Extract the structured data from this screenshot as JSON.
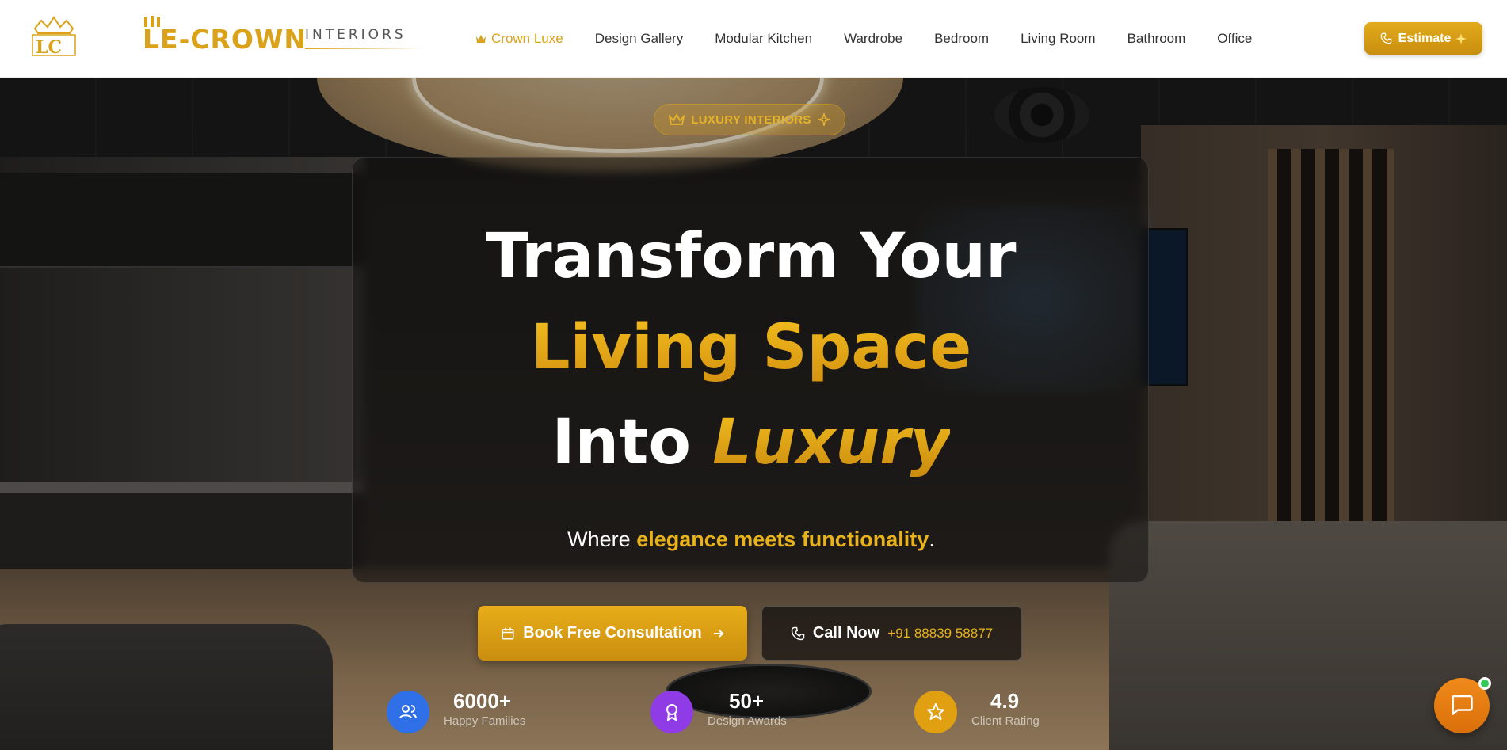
{
  "brand": {
    "name": "LE-CROWN",
    "subtitle": "INTERIORS",
    "monogram": "LC"
  },
  "nav": {
    "items": [
      {
        "label": "Crown Luxe",
        "active": true
      },
      {
        "label": "Design Gallery"
      },
      {
        "label": "Modular Kitchen"
      },
      {
        "label": "Wardrobe"
      },
      {
        "label": "Bedroom"
      },
      {
        "label": "Living Room"
      },
      {
        "label": "Bathroom"
      },
      {
        "label": "Office"
      }
    ],
    "estimate_label": "Estimate"
  },
  "hero": {
    "badge": "LUXURY INTERIORS",
    "heading_line1": "Transform Your",
    "heading_line2": "Living Space",
    "heading_line3_prefix": "Into",
    "heading_line3_highlight": "Luxury",
    "tagline_prefix": "Where",
    "tagline_highlight": "elegance meets functionality",
    "tagline_suffix": ".",
    "cta_primary": "Book Free Consultation",
    "cta_secondary_label": "Call Now",
    "cta_secondary_number": "+91 88839 58877"
  },
  "stats": [
    {
      "value": "6000+",
      "label": "Happy Families",
      "icon": "users-icon",
      "color": "#2f6fe8"
    },
    {
      "value": "50+",
      "label": "Design Awards",
      "icon": "award-icon",
      "color": "#8f3be6"
    },
    {
      "value": "4.9",
      "label": "Client Rating",
      "icon": "star-icon",
      "color": "#e0a012"
    }
  ],
  "colors": {
    "accent_gold": "#d9a21a",
    "chat_orange": "#f08a1a",
    "online_green": "#34c759"
  }
}
